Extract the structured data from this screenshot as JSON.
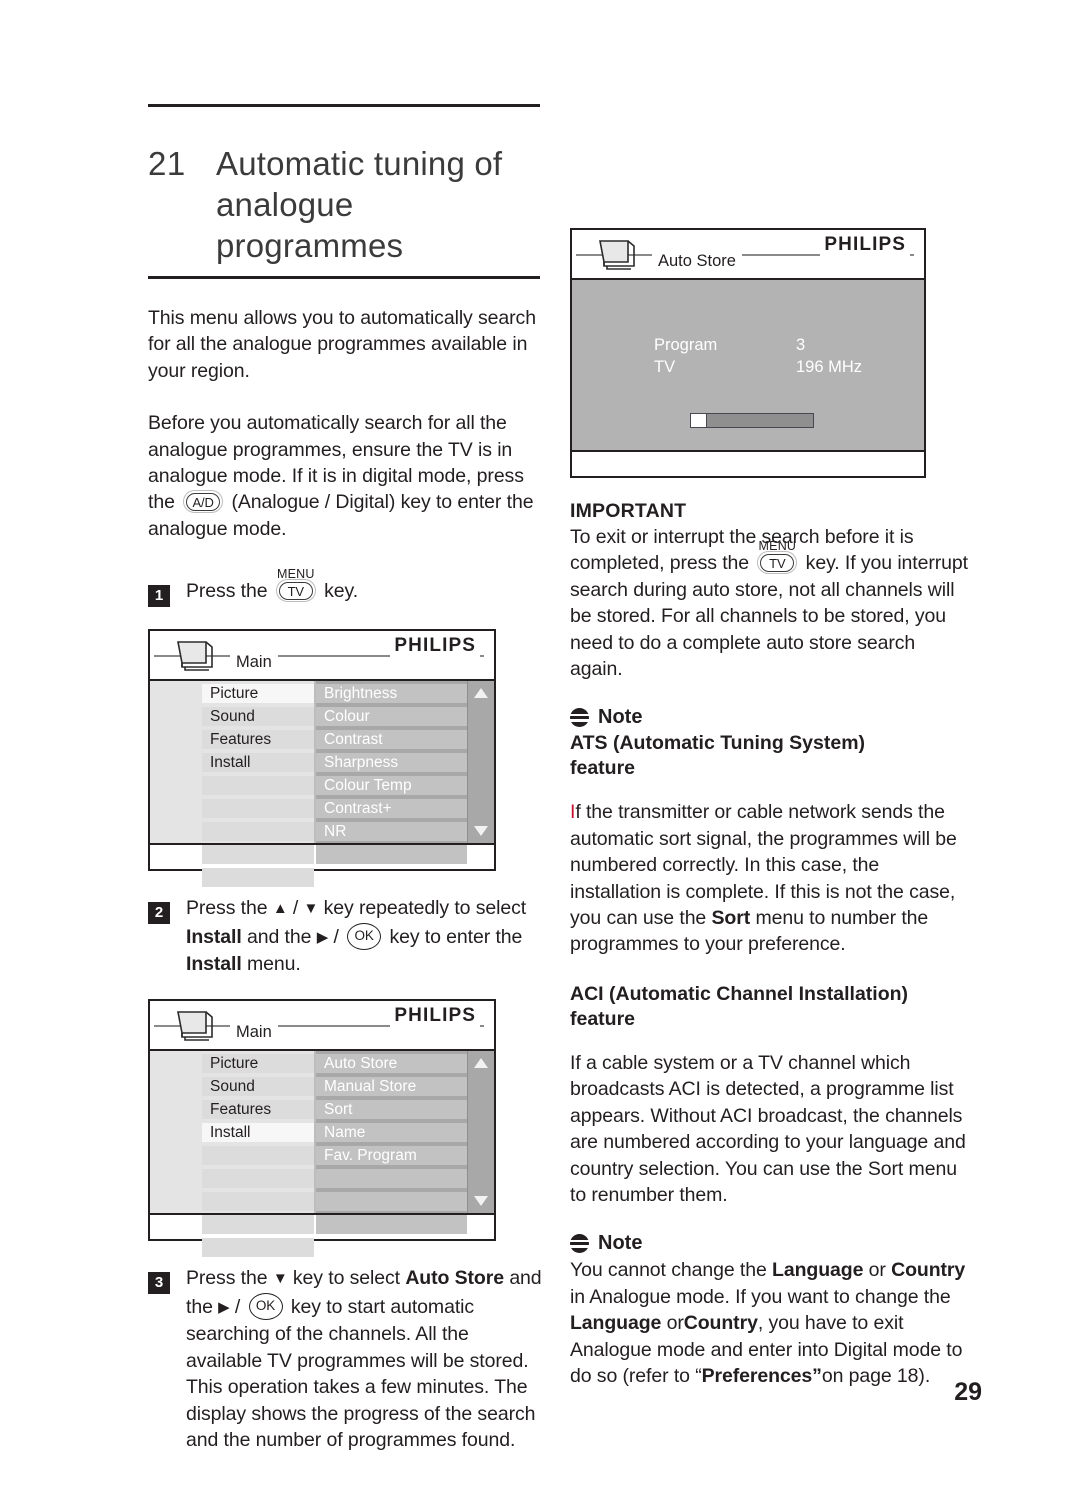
{
  "page": {
    "number": "29",
    "chapter_number": "21",
    "chapter_title_line1": "Automatic tuning of",
    "chapter_title_line2": "analogue programmes"
  },
  "left_column": {
    "intro_paragraph": "This menu allows you to automatically search for all the analogue programmes available in your region.",
    "before_paragraph_part1": "Before you automatically search for all the analogue programmes, ensure the TV is in analogue mode. If it is in digital mode, press the",
    "before_paragraph_key": "A/D",
    "before_paragraph_part2": "(Analogue / Digital) key to enter the analogue mode.",
    "step1": {
      "number": "1",
      "text_before": "Press the",
      "key_cap": "MENU",
      "key_label": "TV",
      "text_after": "key."
    },
    "step2": {
      "number": "2",
      "text_before": "Press the",
      "arrow_up": "▲",
      "slash": "/",
      "arrow_down": "▼",
      "text_mid1": "key repeatedly to select",
      "bold1": "Install",
      "text_mid2": "and the",
      "arrow_right": "▶",
      "ok_label": "OK",
      "text_mid3": "key to enter the",
      "bold2": "Install",
      "text_end": "menu."
    },
    "step3": {
      "number": "3",
      "text_before": "Press the",
      "arrow_down": "▼",
      "text_mid1": "key to select",
      "bold1": "Auto Store",
      "text_mid2": "and the",
      "arrow_right": "▶",
      "ok_label": "OK",
      "text_end": "key to start automatic searching of the channels. All the available TV programmes will be stored. This operation takes a few minutes. The display shows the progress of the search and the number of programmes found."
    }
  },
  "osd_main_menu": {
    "brand": "PHILIPS",
    "title": "Main",
    "left_items": [
      "Picture",
      "Sound",
      "Features",
      "Install"
    ],
    "left_selected": "Picture",
    "left_empty_rows": 5,
    "right_items": [
      "Brightness",
      "Colour",
      "Contrast",
      "Sharpness",
      "Colour Temp",
      "Contrast+",
      "NR"
    ],
    "right_empty_rows": 2,
    "scroll_up_icon": "triangle-up-icon",
    "scroll_down_icon": "triangle-down-icon"
  },
  "osd_install_menu": {
    "brand": "PHILIPS",
    "title": "Main",
    "left_items": [
      "Picture",
      "Sound",
      "Features",
      "Install"
    ],
    "left_selected": "Install",
    "left_empty_rows": 5,
    "right_items": [
      "Auto Store",
      "Manual Store",
      "Sort",
      "Name",
      "Fav. Program"
    ],
    "right_empty_rows": 4,
    "scroll_up_icon": "triangle-up-icon",
    "scroll_down_icon": "triangle-down-icon"
  },
  "osd_auto_store": {
    "brand": "PHILIPS",
    "title": "Auto Store",
    "row1_label": "Program",
    "row1_value": "3",
    "row2_label": "TV",
    "row2_value": "196 MHz",
    "progress_percent": 13
  },
  "right_column": {
    "important": {
      "heading": "IMPORTANT",
      "text_part1": "To exit or interrupt the search before it is completed, press the",
      "key_cap": "MENU",
      "key_label": "TV",
      "text_part2": "key. If you interrupt search during auto store, not all channels will be stored. For all channels to be stored, you need to do a complete auto store search again."
    },
    "note_ats": {
      "note_label": "Note",
      "heading_line1": "ATS (Automatic Tuning System)",
      "heading_line2": "feature",
      "body_red_initial": "I",
      "body_part1": "f the transmitter or cable network sends the automatic sort signal, the programmes will be numbered correctly. In this case, the installation is complete. If this is not the case, you can use the",
      "body_bold": "Sort",
      "body_part2": "menu to number the programmes to your preference."
    },
    "aci": {
      "heading_line1": "ACI (Automatic Channel Installation)",
      "heading_line2": "feature",
      "body": "If a cable system or a TV channel which broadcasts ACI is detected, a programme list appears. Without ACI broadcast, the channels are numbered according to your language and country selection. You can use the Sort menu to renumber them."
    },
    "note_language": {
      "note_label": "Note",
      "part1": "You cannot change the",
      "bold1": "Language",
      "part2": "or",
      "bold2": "Country",
      "part3": "in Analogue mode. If you want to change the",
      "bold3": "Language",
      "part4": "or",
      "bold4": "Country",
      "part5": ", you have to exit Analogue mode and enter into Digital mode to do so (refer to “",
      "bold5": "Preferences”",
      "part6": "on page 18)."
    }
  }
}
